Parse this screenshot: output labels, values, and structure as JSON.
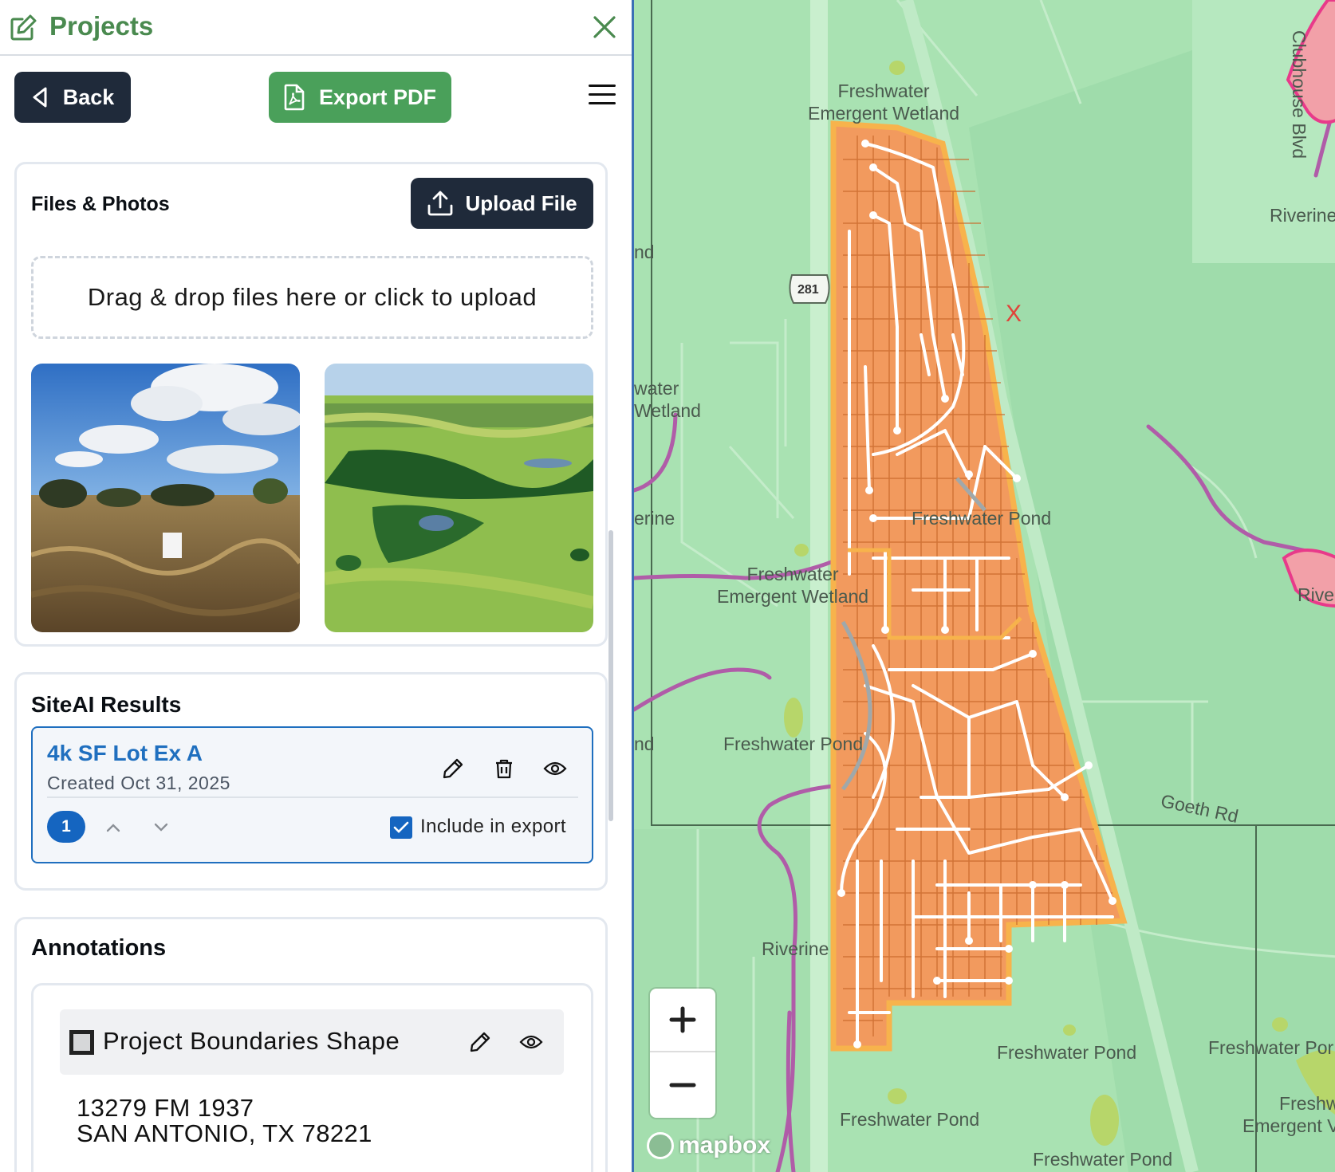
{
  "header": {
    "title": "Projects"
  },
  "toolbar": {
    "back_label": "Back",
    "export_label": "Export PDF"
  },
  "files": {
    "title": "Files & Photos",
    "upload_label": "Upload File",
    "dropzone_text": "Drag & drop files here or click to upload"
  },
  "siteai": {
    "title": "SiteAI Results",
    "result": {
      "name": "4k SF Lot Ex A",
      "created": "Created Oct 31, 2025",
      "rank": "1",
      "include_label": "Include in export",
      "include_checked": true
    }
  },
  "annotations": {
    "title": "Annotations",
    "item_label": "Project Boundaries Shape",
    "address_line1": "13279 FM 1937",
    "address_line2": "SAN ANTONIO, TX 78221"
  },
  "map": {
    "labels": {
      "wetland_top": "Freshwater\nEmergent Wetland",
      "clubhouse": "Clubhouse Blvd",
      "route": "281",
      "riverine_right": "Riverine",
      "nd_top": "nd",
      "water_left": "water\nWetland",
      "erine_left": "erine",
      "pond_center": "Freshwater Pond",
      "wetland_mid": "Freshwater\nEmergent Wetland",
      "river_right2": "River",
      "nd_mid": "nd",
      "pond_left": "Freshwater Pond",
      "goeth": "Goeth Rd",
      "riverine_bottom": "Riverine",
      "pond_bottom1": "Freshwater Pond",
      "pond_bottom_right": "Freshwater Por",
      "wetland_bottom_right": "Freshw\nEmergent V",
      "pond_bottom2": "Freshwater Pond",
      "pond_bottom3": "Freshwater Pond",
      "marker": "X"
    },
    "attribution": "mapbox",
    "colors": {
      "parcel": "#f29a5e",
      "parcel_outline": "#f7b34c",
      "wetland": "#a9e2b2",
      "riverine": "#b05ca8"
    }
  }
}
